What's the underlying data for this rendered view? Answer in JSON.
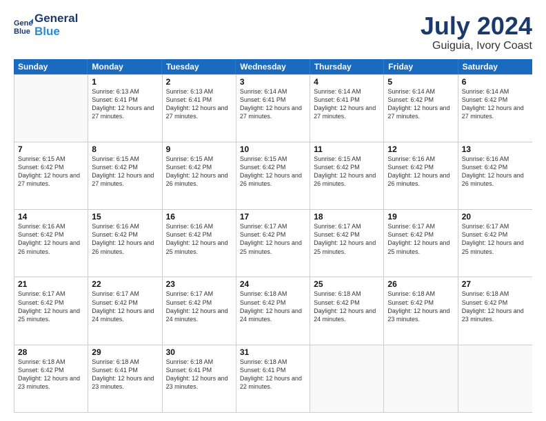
{
  "header": {
    "logo_line1": "General",
    "logo_line2": "Blue",
    "month": "July 2024",
    "location": "Guiguia, Ivory Coast"
  },
  "weekdays": [
    "Sunday",
    "Monday",
    "Tuesday",
    "Wednesday",
    "Thursday",
    "Friday",
    "Saturday"
  ],
  "weeks": [
    [
      {
        "day": "",
        "empty": true
      },
      {
        "day": "1",
        "sunrise": "6:13 AM",
        "sunset": "6:41 PM",
        "daylight": "12 hours and 27 minutes."
      },
      {
        "day": "2",
        "sunrise": "6:13 AM",
        "sunset": "6:41 PM",
        "daylight": "12 hours and 27 minutes."
      },
      {
        "day": "3",
        "sunrise": "6:14 AM",
        "sunset": "6:41 PM",
        "daylight": "12 hours and 27 minutes."
      },
      {
        "day": "4",
        "sunrise": "6:14 AM",
        "sunset": "6:41 PM",
        "daylight": "12 hours and 27 minutes."
      },
      {
        "day": "5",
        "sunrise": "6:14 AM",
        "sunset": "6:42 PM",
        "daylight": "12 hours and 27 minutes."
      },
      {
        "day": "6",
        "sunrise": "6:14 AM",
        "sunset": "6:42 PM",
        "daylight": "12 hours and 27 minutes."
      }
    ],
    [
      {
        "day": "7",
        "sunrise": "6:15 AM",
        "sunset": "6:42 PM",
        "daylight": "12 hours and 27 minutes."
      },
      {
        "day": "8",
        "sunrise": "6:15 AM",
        "sunset": "6:42 PM",
        "daylight": "12 hours and 27 minutes."
      },
      {
        "day": "9",
        "sunrise": "6:15 AM",
        "sunset": "6:42 PM",
        "daylight": "12 hours and 26 minutes."
      },
      {
        "day": "10",
        "sunrise": "6:15 AM",
        "sunset": "6:42 PM",
        "daylight": "12 hours and 26 minutes."
      },
      {
        "day": "11",
        "sunrise": "6:15 AM",
        "sunset": "6:42 PM",
        "daylight": "12 hours and 26 minutes."
      },
      {
        "day": "12",
        "sunrise": "6:16 AM",
        "sunset": "6:42 PM",
        "daylight": "12 hours and 26 minutes."
      },
      {
        "day": "13",
        "sunrise": "6:16 AM",
        "sunset": "6:42 PM",
        "daylight": "12 hours and 26 minutes."
      }
    ],
    [
      {
        "day": "14",
        "sunrise": "6:16 AM",
        "sunset": "6:42 PM",
        "daylight": "12 hours and 26 minutes."
      },
      {
        "day": "15",
        "sunrise": "6:16 AM",
        "sunset": "6:42 PM",
        "daylight": "12 hours and 26 minutes."
      },
      {
        "day": "16",
        "sunrise": "6:16 AM",
        "sunset": "6:42 PM",
        "daylight": "12 hours and 25 minutes."
      },
      {
        "day": "17",
        "sunrise": "6:17 AM",
        "sunset": "6:42 PM",
        "daylight": "12 hours and 25 minutes."
      },
      {
        "day": "18",
        "sunrise": "6:17 AM",
        "sunset": "6:42 PM",
        "daylight": "12 hours and 25 minutes."
      },
      {
        "day": "19",
        "sunrise": "6:17 AM",
        "sunset": "6:42 PM",
        "daylight": "12 hours and 25 minutes."
      },
      {
        "day": "20",
        "sunrise": "6:17 AM",
        "sunset": "6:42 PM",
        "daylight": "12 hours and 25 minutes."
      }
    ],
    [
      {
        "day": "21",
        "sunrise": "6:17 AM",
        "sunset": "6:42 PM",
        "daylight": "12 hours and 25 minutes."
      },
      {
        "day": "22",
        "sunrise": "6:17 AM",
        "sunset": "6:42 PM",
        "daylight": "12 hours and 24 minutes."
      },
      {
        "day": "23",
        "sunrise": "6:17 AM",
        "sunset": "6:42 PM",
        "daylight": "12 hours and 24 minutes."
      },
      {
        "day": "24",
        "sunrise": "6:18 AM",
        "sunset": "6:42 PM",
        "daylight": "12 hours and 24 minutes."
      },
      {
        "day": "25",
        "sunrise": "6:18 AM",
        "sunset": "6:42 PM",
        "daylight": "12 hours and 24 minutes."
      },
      {
        "day": "26",
        "sunrise": "6:18 AM",
        "sunset": "6:42 PM",
        "daylight": "12 hours and 23 minutes."
      },
      {
        "day": "27",
        "sunrise": "6:18 AM",
        "sunset": "6:42 PM",
        "daylight": "12 hours and 23 minutes."
      }
    ],
    [
      {
        "day": "28",
        "sunrise": "6:18 AM",
        "sunset": "6:42 PM",
        "daylight": "12 hours and 23 minutes."
      },
      {
        "day": "29",
        "sunrise": "6:18 AM",
        "sunset": "6:41 PM",
        "daylight": "12 hours and 23 minutes."
      },
      {
        "day": "30",
        "sunrise": "6:18 AM",
        "sunset": "6:41 PM",
        "daylight": "12 hours and 23 minutes."
      },
      {
        "day": "31",
        "sunrise": "6:18 AM",
        "sunset": "6:41 PM",
        "daylight": "12 hours and 22 minutes."
      },
      {
        "day": "",
        "empty": true
      },
      {
        "day": "",
        "empty": true
      },
      {
        "day": "",
        "empty": true
      }
    ]
  ]
}
